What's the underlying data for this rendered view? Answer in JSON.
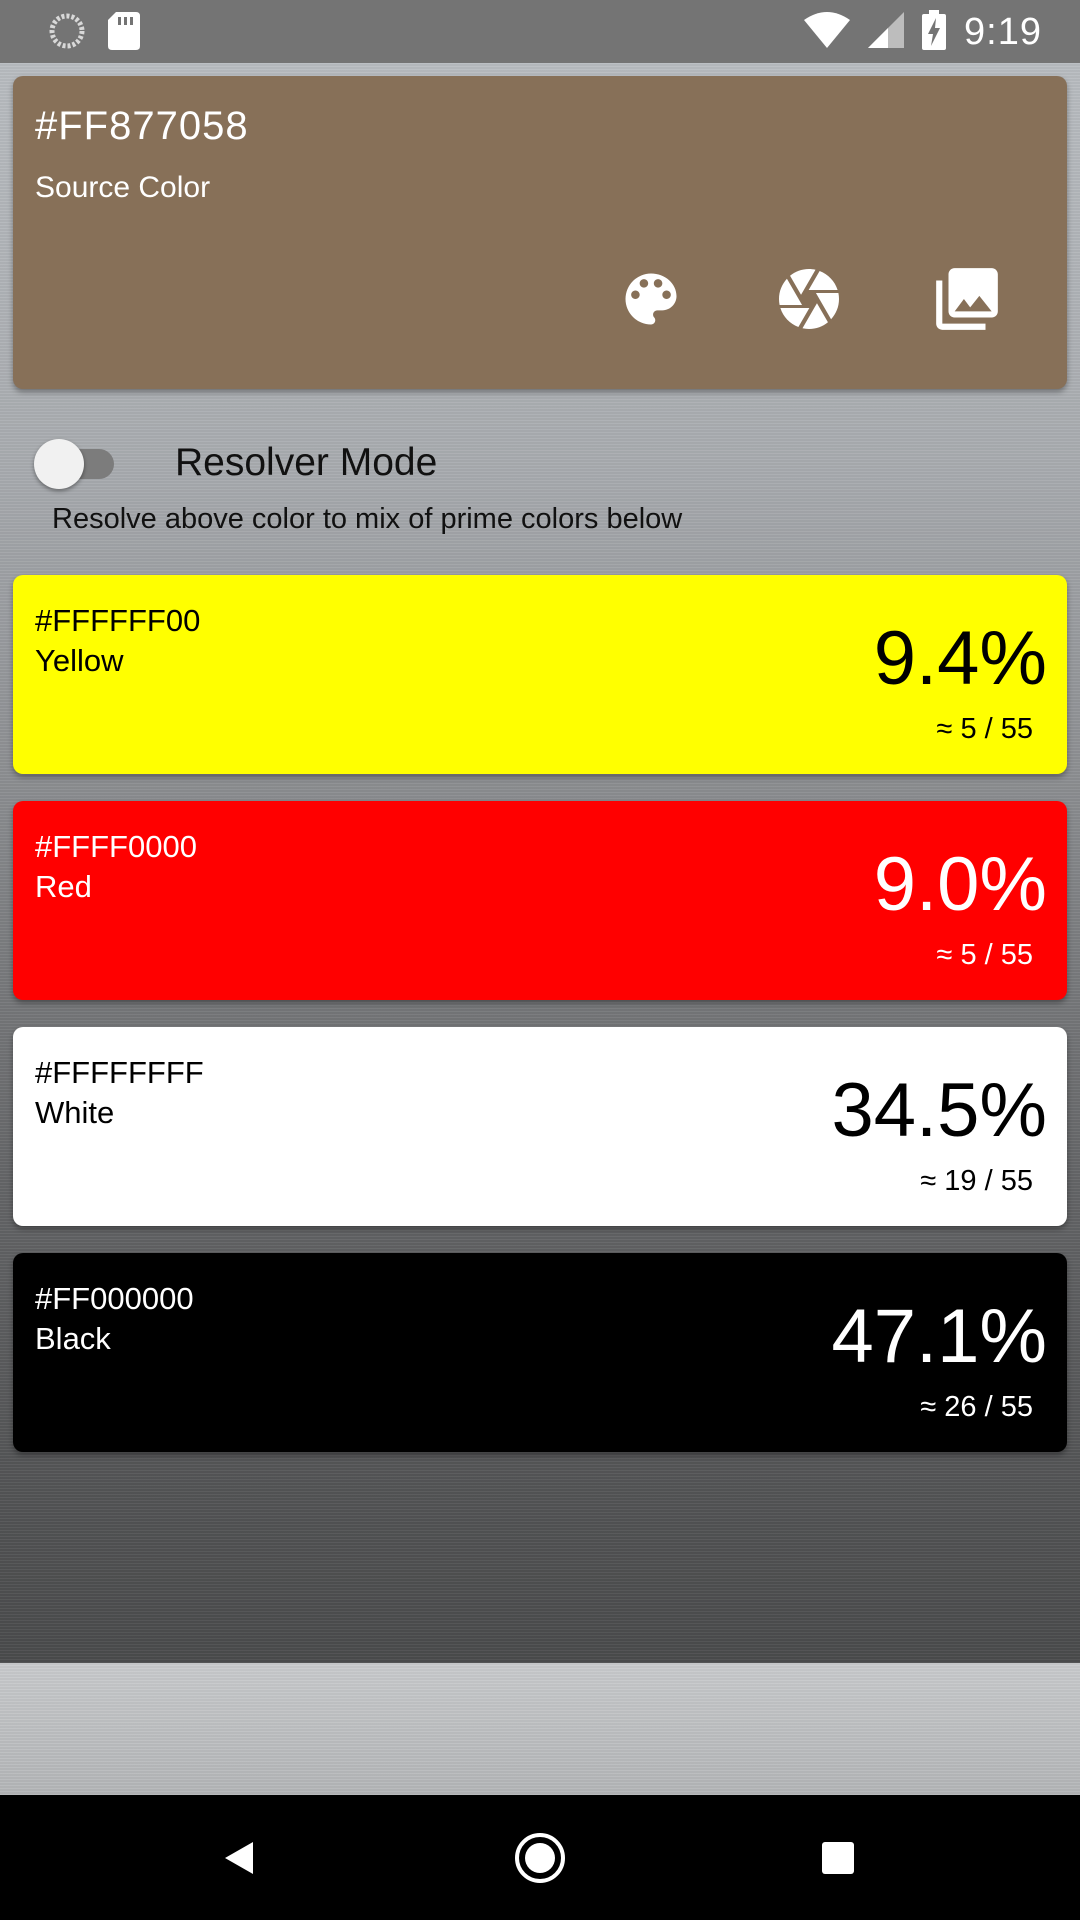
{
  "status_bar": {
    "time": "9:19",
    "icons": [
      "sync-icon",
      "sd-card-icon",
      "wifi-icon",
      "signal-icon",
      "battery-charging-icon"
    ]
  },
  "source": {
    "hex": "#FF877058",
    "label": "Source Color",
    "color": "#877058",
    "actions": [
      "palette-icon",
      "camera-shutter-icon",
      "gallery-icon"
    ]
  },
  "resolver": {
    "title": "Resolver Mode",
    "description": "Resolve above color to mix of prime colors below",
    "enabled": false
  },
  "primes": [
    {
      "hex": "#FFFFFF00",
      "name": "Yellow",
      "percent": "9.4%",
      "ratio": "≈ 5 / 55",
      "bg": "#ffff00",
      "fg": "#000000"
    },
    {
      "hex": "#FFFF0000",
      "name": "Red",
      "percent": "9.0%",
      "ratio": "≈ 5 / 55",
      "bg": "#ff0000",
      "fg": "#ffffff"
    },
    {
      "hex": "#FFFFFFFF",
      "name": "White",
      "percent": "34.5%",
      "ratio": "≈ 19 / 55",
      "bg": "#ffffff",
      "fg": "#000000"
    },
    {
      "hex": "#FF000000",
      "name": "Black",
      "percent": "47.1%",
      "ratio": "≈ 26 / 55",
      "bg": "#000000",
      "fg": "#ffffff"
    }
  ],
  "nav": [
    "back-icon",
    "home-icon",
    "recents-icon"
  ]
}
